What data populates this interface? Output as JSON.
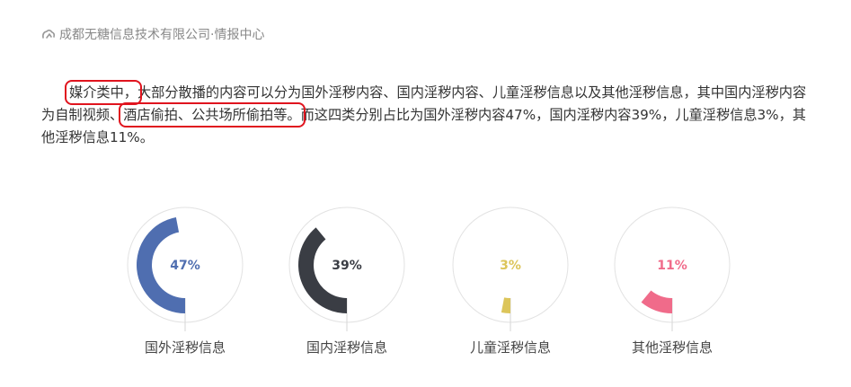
{
  "source": {
    "icon": "link-cloud-icon",
    "text": "成都无糖信息技术有限公司·情报中心"
  },
  "paragraph": {
    "highlight_1": "媒介类中，",
    "text_1": "大部分散播的内容可以分为国外淫秽内容、国内淫秽内容、儿童淫秽信息以及其他淫秽信息，其中国内淫秽内容为自制视频、",
    "highlight_2": "酒店偷拍、公共场所偷拍等。",
    "text_2": "而这四类分别占比为国外淫秽内容47%，国内淫秽内容39%，儿童淫秽信息3%，其他淫秽信息11%。"
  },
  "chart_data": {
    "type": "pie",
    "categories": [
      "国外淫秽信息",
      "国内淫秽信息",
      "儿童淫秽信息",
      "其他淫秽信息"
    ],
    "values": [
      47,
      39,
      3,
      11
    ],
    "labels": [
      "47%",
      "39%",
      "3%",
      "11%"
    ],
    "colors": [
      "#4f6eb0",
      "#3a3d44",
      "#dcc55a",
      "#f06b8a"
    ]
  }
}
